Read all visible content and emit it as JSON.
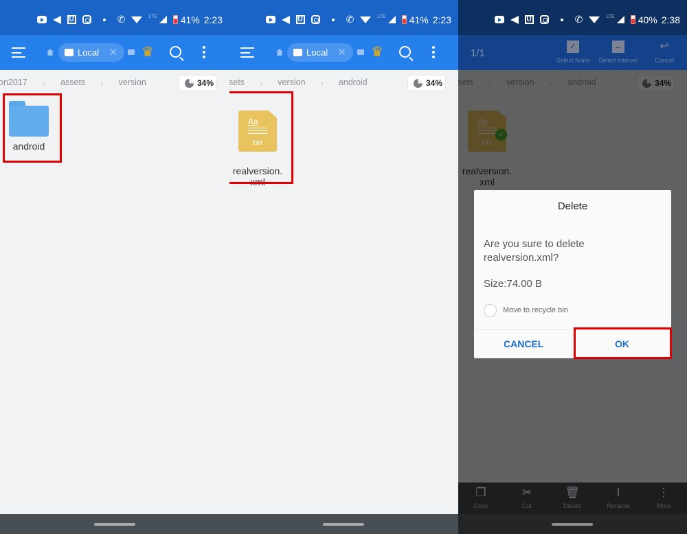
{
  "panels": [
    {
      "status": {
        "battery": "41%",
        "time": "2:23",
        "network": "LTE"
      },
      "toolbar": {
        "location_chip": "Local"
      },
      "breadcrumb": [
        "on2017",
        "assets",
        "version"
      ],
      "storage_usage": "34%",
      "items": [
        {
          "name": "android",
          "type": "folder",
          "icon": "folder-icon"
        }
      ]
    },
    {
      "status": {
        "battery": "41%",
        "time": "2:23",
        "network": "LTE"
      },
      "toolbar": {
        "location_chip": "Local"
      },
      "breadcrumb": [
        "sets",
        "version",
        "android"
      ],
      "storage_usage": "34%",
      "items": [
        {
          "name": "realversion.\nxml",
          "type": "txt",
          "icon": "txt-file-icon",
          "icon_label": "TXT",
          "icon_glyph": "Aa"
        }
      ]
    },
    {
      "status": {
        "battery": "40%",
        "time": "2:38",
        "network": "LTE"
      },
      "selection_toolbar": {
        "count": "1/1",
        "actions": [
          {
            "label": "Select None",
            "icon": "check-box-icon"
          },
          {
            "label": "Select Interval",
            "icon": "interval-icon"
          },
          {
            "label": "Cancel",
            "icon": "return-icon"
          }
        ]
      },
      "breadcrumb": [
        "sets",
        "version",
        "android"
      ],
      "storage_usage": "34%",
      "items": [
        {
          "name": "realversion.\nxml",
          "type": "txt",
          "icon": "txt-file-icon",
          "selected": true,
          "icon_label": "TXT",
          "icon_glyph": "Aa"
        }
      ],
      "dialog": {
        "title": "Delete",
        "message": "Are you sure to delete realversion.xml?",
        "size": "Size:74.00 B",
        "recycle_label": "Move to recycle bin",
        "recycle_checked": false,
        "cancel": "CANCEL",
        "ok": "OK"
      },
      "bottom_actions": [
        {
          "label": "Copy",
          "icon": "copy-icon"
        },
        {
          "label": "Cut",
          "icon": "scissors-icon"
        },
        {
          "label": "Delete",
          "icon": "trash-icon"
        },
        {
          "label": "Rename",
          "icon": "text-cursor-icon"
        },
        {
          "label": "More",
          "icon": "more-vertical-icon"
        }
      ]
    }
  ],
  "colors": {
    "status_bar": "#1a63c7",
    "toolbar": "#2680eb",
    "highlight": "#e00000",
    "dialog_button": "#1a6fce"
  }
}
